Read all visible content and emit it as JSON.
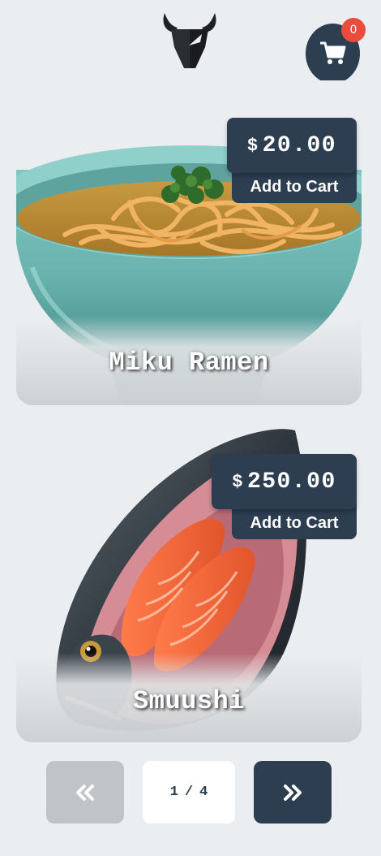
{
  "header": {
    "logo_icon": "bull-head-icon",
    "cart_icon": "shopping-cart-icon",
    "cart_count": "0"
  },
  "products": [
    {
      "name": "Miku Ramen",
      "currency": "$",
      "price": "20.00",
      "add_label": "Add to Cart"
    },
    {
      "name": "Smuushi",
      "currency": "$",
      "price": "250.00",
      "add_label": "Add to Cart"
    }
  ],
  "pagination": {
    "prev_icon": "double-chevron-left-icon",
    "next_icon": "double-chevron-right-icon",
    "current_page": "1",
    "separator": "/",
    "total_pages": "4"
  },
  "colors": {
    "background": "#ebeef0",
    "primary": "#2c3e50",
    "badge": "#e74c3c",
    "disabled": "#bfc4c8"
  }
}
